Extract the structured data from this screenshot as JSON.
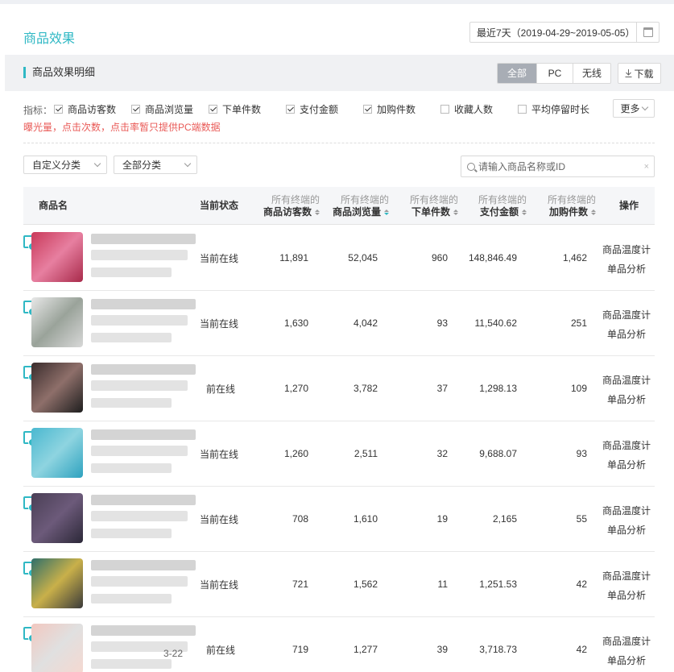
{
  "header": {
    "title": "商品效果",
    "date_range": "最近7天（2019-04-29~2019-05-05）"
  },
  "section": {
    "title": "商品效果明细",
    "terminals": [
      "全部",
      "PC",
      "无线"
    ],
    "active_terminal": "全部",
    "download_label": "下载"
  },
  "metrics": {
    "label": "指标：",
    "items": [
      {
        "label": "商品访客数",
        "checked": true
      },
      {
        "label": "商品浏览量",
        "checked": true
      },
      {
        "label": "下单件数",
        "checked": true
      },
      {
        "label": "支付金额",
        "checked": true
      },
      {
        "label": "加购件数",
        "checked": true
      },
      {
        "label": "收藏人数",
        "checked": false
      },
      {
        "label": "平均停留时长",
        "checked": false
      }
    ],
    "more_label": "更多",
    "notice": "曝光量，点击次数，点击率暂只提供PC端数据"
  },
  "filters": {
    "custom_category": "自定义分类",
    "all_category": "全部分类",
    "search_placeholder": "请输入商品名称或ID"
  },
  "table": {
    "col_product": "商品名",
    "col_status": "当前状态",
    "col_prefix": "所有终端的",
    "col_visitors": "商品访客数",
    "col_views": "商品浏览量",
    "col_orders": "下单件数",
    "col_payment": "支付金额",
    "col_cart": "加购件数",
    "col_ops": "操作",
    "rows": [
      {
        "status": "当前在线",
        "visitors": "11,891",
        "views": "52,045",
        "orders": "960",
        "payment": "148,846.49",
        "cart": "1,462",
        "op1": "商品温度计",
        "op2": "单品分析"
      },
      {
        "status": "当前在线",
        "visitors": "1,630",
        "views": "4,042",
        "orders": "93",
        "payment": "11,540.62",
        "cart": "251",
        "op1": "商品温度计",
        "op2": "单品分析"
      },
      {
        "status": "前在线",
        "visitors": "1,270",
        "views": "3,782",
        "orders": "37",
        "payment": "1,298.13",
        "cart": "109",
        "op1": "商品温度计",
        "op2": "单品分析"
      },
      {
        "status": "当前在线",
        "visitors": "1,260",
        "views": "2,511",
        "orders": "32",
        "payment": "9,688.07",
        "cart": "93",
        "op1": "商品温度计",
        "op2": "单品分析"
      },
      {
        "status": "当前在线",
        "visitors": "708",
        "views": "1,610",
        "orders": "19",
        "payment": "2,165",
        "cart": "55",
        "op1": "商品温度计",
        "op2": "单品分析"
      },
      {
        "status": "当前在线",
        "visitors": "721",
        "views": "1,562",
        "orders": "11",
        "payment": "1,251.53",
        "cart": "42",
        "op1": "商品温度计",
        "op2": "单品分析"
      },
      {
        "status": "前在线",
        "visitors": "719",
        "views": "1,277",
        "orders": "39",
        "payment": "3,718.73",
        "cart": "42",
        "op1": "商品温度计",
        "op2": "单品分析",
        "extra": "3-22"
      }
    ]
  },
  "colors": {
    "accent": "#2fb8c4",
    "notice": "#e95a57",
    "active_segment": "#a8adb5"
  },
  "icons": [
    "calendar-icon",
    "download-icon",
    "search-icon",
    "chevron-down-icon",
    "mobile-icon",
    "sort-icon"
  ]
}
